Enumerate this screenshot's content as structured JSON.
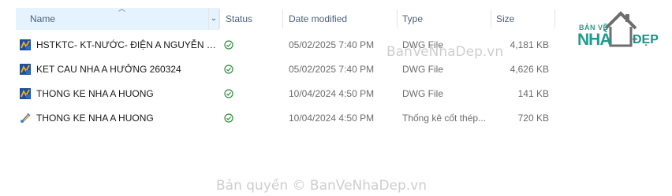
{
  "columns": {
    "name": "Name",
    "status": "Status",
    "date": "Date modified",
    "type": "Type",
    "size": "Size"
  },
  "files": [
    {
      "name": "HSTKTC- KT-NƯỚC-  ĐIỆN A NGUYỄN VĂ...",
      "date": "05/02/2025 7:40 PM",
      "type": "DWG File",
      "size": "4,181 KB",
      "icon": "dwg-file-icon",
      "status": "synced-icon"
    },
    {
      "name": "KET CAU NHA A HƯỞNG 260324",
      "date": "05/02/2025 7:40 PM",
      "type": "DWG File",
      "size": "4,626 KB",
      "icon": "dwg-file-icon",
      "status": "synced-icon"
    },
    {
      "name": "THONG KE NHA A HUONG",
      "date": "10/04/2024 4:50 PM",
      "type": "DWG File",
      "size": "141 KB",
      "icon": "dwg-file-icon",
      "status": "synced-icon"
    },
    {
      "name": "THONG KE NHA A HUONG",
      "date": "10/04/2024 4:50 PM",
      "type": "Thống kê cốt thép...",
      "size": "720 KB",
      "icon": "rebar-stats-file-icon",
      "status": "synced-icon"
    }
  ],
  "logo": {
    "top": "BẢN VẼ",
    "main": "NHÀ",
    "side": "ĐẸP"
  },
  "watermarks": {
    "site": "BanVeNhaDep.vn",
    "copyright": "Bản quyền © BanVeNhaDep.vn"
  },
  "colors": {
    "accent": "#1e9c8f",
    "header_active": "#e5f3ff",
    "status_green": "#2e8b3d"
  }
}
